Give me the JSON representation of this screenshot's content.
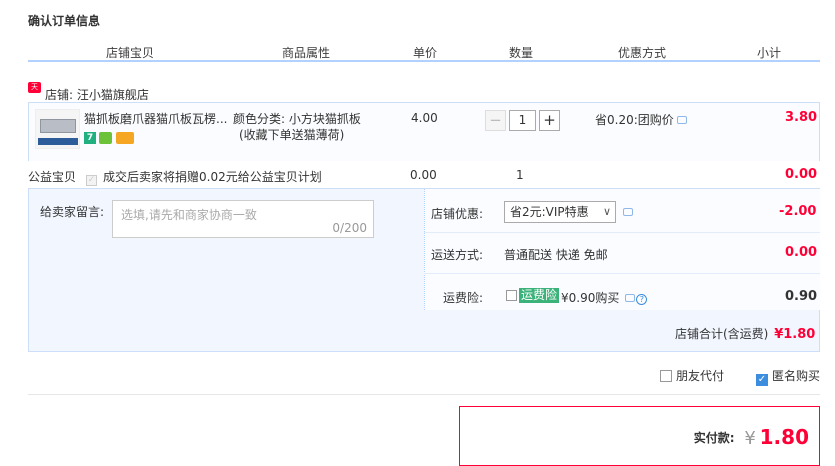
{
  "page": {
    "title": "确认订单信息"
  },
  "columns": [
    "店铺宝贝",
    "商品属性",
    "单价",
    "数量",
    "优惠方式",
    "小计"
  ],
  "shop": {
    "badge": "天猫",
    "label": "店铺: 汪小猫旗舰店"
  },
  "item": {
    "title": "猫抓板磨爪器猫爪板瓦楞...",
    "attr_line1": "颜色分类: 小方块猫抓板",
    "attr_line2": "(收藏下单送猫薄荷)",
    "price": "4.00",
    "quantity": "1",
    "minus": "−",
    "plus": "+",
    "discount": "省0.20:团购价",
    "subtotal": "3.80",
    "tag": "7"
  },
  "charity": {
    "label": "公益宝贝",
    "check": "✓",
    "desc": "成交后卖家将捐赠0.02元给公益宝贝计划",
    "price": "0.00",
    "quantity": "1",
    "subtotal": "0.00"
  },
  "message": {
    "label": "给卖家留言:",
    "placeholder": "选填,请先和商家协商一致",
    "count": "0/200"
  },
  "shop_discount": {
    "label": "店铺优惠:",
    "value": "省2元:VIP特惠",
    "chevron": "∨",
    "amount": "-2.00"
  },
  "shipping": {
    "label": "运送方式:",
    "value": "普通配送 快递 免邮",
    "amount": "0.00"
  },
  "insurance": {
    "label": "运费险:",
    "badge": "运费险",
    "text": "¥0.90购买",
    "help": "?",
    "amount": "0.90"
  },
  "shop_total": {
    "label": "店铺合计(含运费)",
    "amount": "¥1.80"
  },
  "options": {
    "friend_pay": "朋友代付",
    "anonymous": "匿名购买",
    "check": "✓"
  },
  "payment": {
    "label": "实付款:",
    "currency": "¥",
    "amount": "1.80"
  }
}
